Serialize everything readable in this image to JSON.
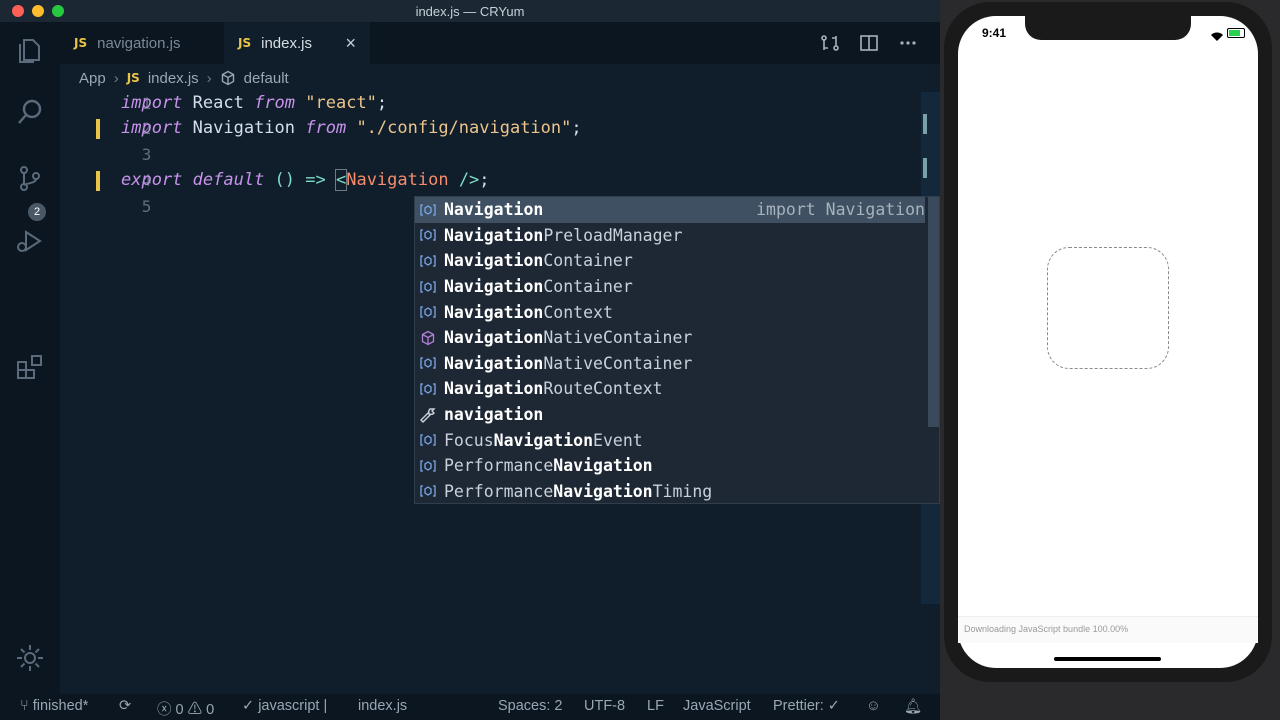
{
  "window": {
    "title": "index.js — CRYum"
  },
  "tabs": [
    {
      "label": "navigation.js",
      "badge": "JS"
    },
    {
      "label": "index.js",
      "badge": "JS",
      "close": "×"
    }
  ],
  "breadcrumb": {
    "folder": "App",
    "file_badge": "JS",
    "file": "index.js",
    "symbol": "default"
  },
  "activity_bar": {
    "scm_badge": "2"
  },
  "editor": {
    "lines": [
      {
        "n": "1"
      },
      {
        "n": "2"
      },
      {
        "n": "3"
      },
      {
        "n": "4"
      },
      {
        "n": "5"
      }
    ],
    "l1": {
      "kw1": "import",
      "id": " React ",
      "kw2": "from",
      "str": " \"react\"",
      "end": ";"
    },
    "l2": {
      "kw1": "import",
      "id": " Navigation ",
      "kw2": "from",
      "str": " \"./config/navigation\"",
      "end": ";"
    },
    "l4": {
      "kw1": "export",
      "kw2": " default",
      "rest": " () => ",
      "lt": "<",
      "tag": "Navigation",
      "close": " />",
      "end": ";"
    }
  },
  "suggestions": [
    {
      "bold": "Navigation",
      "rest": "",
      "pre": "",
      "detail": "import Navigation",
      "icon": "symbol-variable-icon",
      "selected": true
    },
    {
      "pre": "",
      "bold": "Navigation",
      "rest": "PreloadManager",
      "icon": "symbol-variable-icon"
    },
    {
      "pre": "",
      "bold": "Navigation",
      "rest": "Container",
      "icon": "symbol-variable-icon"
    },
    {
      "pre": "",
      "bold": "Navigation",
      "rest": "Container",
      "icon": "symbol-variable-icon"
    },
    {
      "pre": "",
      "bold": "Navigation",
      "rest": "Context",
      "icon": "symbol-variable-icon"
    },
    {
      "pre": "",
      "bold": "Navigation",
      "rest": "NativeContainer",
      "icon": "symbol-module-icon"
    },
    {
      "pre": "",
      "bold": "Navigation",
      "rest": "NativeContainer",
      "icon": "symbol-variable-icon"
    },
    {
      "pre": "",
      "bold": "Navigation",
      "rest": "RouteContext",
      "icon": "symbol-variable-icon"
    },
    {
      "pre": "",
      "bold": "navigation",
      "rest": "",
      "icon": "wrench-icon"
    },
    {
      "pre": "Focus",
      "bold": "Navigation",
      "rest": "Event",
      "icon": "symbol-variable-icon"
    },
    {
      "pre": "Performance",
      "bold": "Navigation",
      "rest": "",
      "icon": "symbol-variable-icon"
    },
    {
      "pre": "Performance",
      "bold": "Navigation",
      "rest": "Timing",
      "icon": "symbol-variable-icon"
    }
  ],
  "status": {
    "branch": "finished*",
    "errors": "0",
    "warnings": "0",
    "language_check": "javascript",
    "pipe": "|",
    "file": "index.js",
    "spaces": "Spaces: 2",
    "encoding": "UTF-8",
    "eol": "LF",
    "language": "JavaScript",
    "prettier": "Prettier: ✓"
  },
  "simulator": {
    "time": "9:41",
    "loading_text": "Downloading JavaScript bundle 100.00%"
  },
  "colors": {
    "accent_yellow": "#e8c449",
    "selection": "#3e5061",
    "keyword": "#c792ea",
    "string": "#ecc48d"
  }
}
